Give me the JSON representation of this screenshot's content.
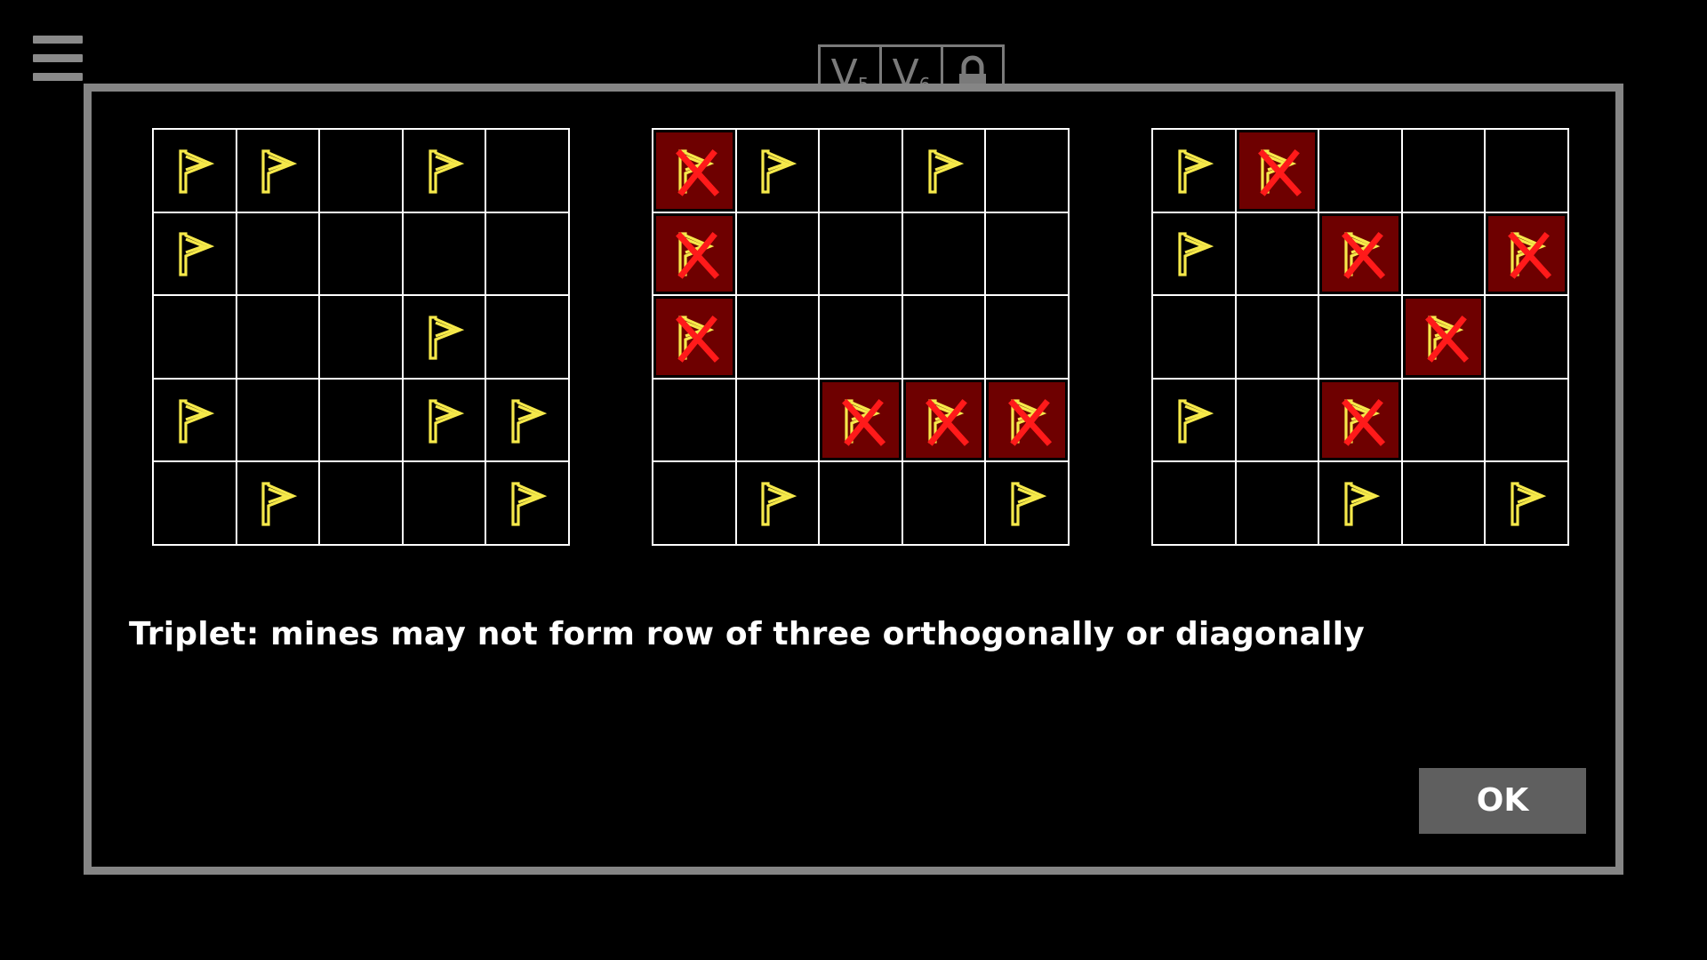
{
  "menu": {
    "icon": "hamburger-menu-icon"
  },
  "variant_tabs": [
    {
      "letter": "V",
      "sub": "5"
    },
    {
      "letter": "V",
      "sub": "6"
    },
    {
      "icon": "lock-icon"
    }
  ],
  "dialog": {
    "rule_text": "Triplet: mines may not form row of three orthogonally or diagonally",
    "ok_label": "OK",
    "examples": [
      {
        "cells": [
          [
            "F",
            "F",
            "-",
            "F",
            "-"
          ],
          [
            "F",
            "-",
            "-",
            "-",
            "-"
          ],
          [
            "-",
            "-",
            "-",
            "F",
            "-"
          ],
          [
            "F",
            "-",
            "-",
            "F",
            "F"
          ],
          [
            "-",
            "F",
            "-",
            "-",
            "F"
          ]
        ]
      },
      {
        "cells": [
          [
            "X",
            "F",
            "-",
            "F",
            "-"
          ],
          [
            "X",
            "-",
            "-",
            "-",
            "-"
          ],
          [
            "X",
            "-",
            "-",
            "-",
            "-"
          ],
          [
            "-",
            "-",
            "X",
            "X",
            "X"
          ],
          [
            "-",
            "F",
            "-",
            "-",
            "F"
          ]
        ]
      },
      {
        "cells": [
          [
            "F",
            "X",
            "-",
            "-",
            "-"
          ],
          [
            "F",
            "-",
            "X",
            "-",
            "X"
          ],
          [
            "-",
            "-",
            "-",
            "X",
            "-"
          ],
          [
            "F",
            "-",
            "X",
            "-",
            "-"
          ],
          [
            "-",
            "-",
            "F",
            "-",
            "F"
          ]
        ]
      }
    ],
    "legend": {
      "F": "flag-icon",
      "X": "invalid-mine-cross-icon",
      "-": "empty"
    },
    "colors": {
      "flag": "#f6e94a",
      "invalid_bg": "#6e0000",
      "cross": "#ff1a1a",
      "frame": "#858585",
      "ok_bg": "#5f5f5f"
    }
  }
}
